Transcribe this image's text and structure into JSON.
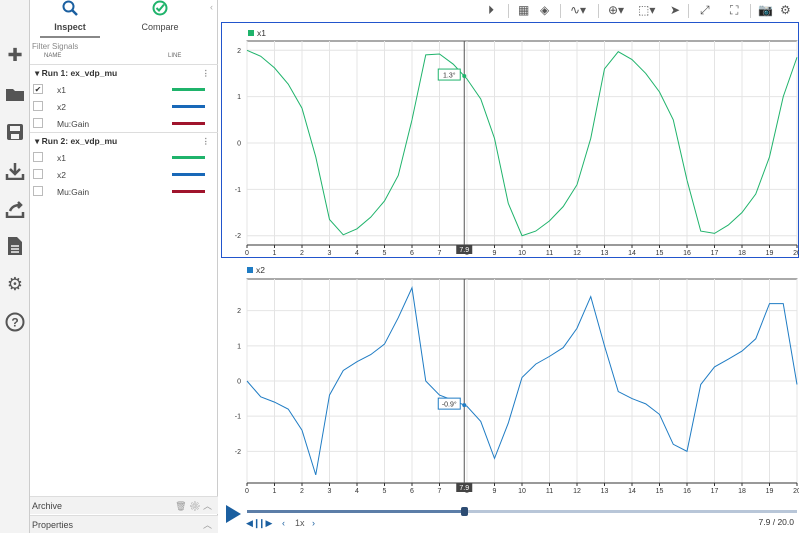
{
  "sidebar_icons": [
    "add-icon",
    "folder-icon",
    "save-icon",
    "download-icon",
    "share-icon",
    "report-icon",
    "settings-icon",
    "help-icon"
  ],
  "tabs": {
    "inspect": "Inspect",
    "compare": "Compare"
  },
  "filter_placeholder": "Filter Signals",
  "columns": {
    "name": "NAME",
    "line": "LINE"
  },
  "runs": [
    {
      "label": "Run 1: ex_vdp_mu",
      "signals": [
        {
          "name": "x1",
          "color": "#1fb36b",
          "checked": true
        },
        {
          "name": "x2",
          "color": "#1868b8",
          "checked": false
        },
        {
          "name": "Mu:Gain",
          "color": "#a0142c",
          "checked": false
        }
      ]
    },
    {
      "label": "Run 2: ex_vdp_mu",
      "signals": [
        {
          "name": "x1",
          "color": "#1fb36b",
          "checked": false
        },
        {
          "name": "x2",
          "color": "#1868b8",
          "checked": false
        },
        {
          "name": "Mu:Gain",
          "color": "#a0142c",
          "checked": false
        }
      ]
    }
  ],
  "archive": "Archive",
  "properties": "Properties",
  "toolbar_icons": [
    "play-record-icon",
    "layout-icon",
    "eraser-icon",
    "signal-style-icon",
    "zoom-icon",
    "fit-icon",
    "cursor-icon",
    "expand-icon",
    "fullscreen-icon",
    "camera-icon",
    "settings-icon"
  ],
  "cursor_time": 7.9,
  "playback": {
    "speed": "1x",
    "time": "7.9 / 20.0",
    "progress": 0.395
  },
  "chart_data": [
    {
      "type": "line",
      "title": "x1",
      "color": "#1fb36b",
      "xlim": [
        0,
        20
      ],
      "ylim": [
        -2.2,
        2.2
      ],
      "yticks": [
        -2,
        -1,
        0,
        1,
        2
      ],
      "xticks": [
        0,
        1,
        2,
        3,
        4,
        5,
        6,
        7,
        8,
        9,
        10,
        11,
        12,
        13,
        14,
        15,
        16,
        17,
        18,
        19,
        20
      ],
      "cursor_value": "1.3°",
      "x": [
        0,
        0.5,
        1,
        1.5,
        2,
        2.5,
        3,
        3.5,
        4,
        4.5,
        5,
        5.5,
        6,
        6.5,
        7,
        7.5,
        8,
        8.5,
        9,
        9.5,
        10,
        10.5,
        11,
        11.5,
        12,
        12.5,
        13,
        13.5,
        14,
        14.5,
        15,
        15.5,
        16,
        16.5,
        17,
        17.5,
        18,
        18.5,
        19,
        19.5,
        20
      ],
      "y": [
        2.0,
        1.87,
        1.62,
        1.27,
        0.75,
        -0.3,
        -1.65,
        -1.98,
        -1.85,
        -1.6,
        -1.25,
        -0.7,
        0.5,
        1.9,
        1.92,
        1.7,
        1.38,
        0.95,
        0.1,
        -1.3,
        -2.0,
        -1.9,
        -1.68,
        -1.37,
        -0.9,
        0.1,
        1.6,
        1.97,
        1.8,
        1.5,
        1.1,
        0.5,
        -0.8,
        -1.9,
        -1.95,
        -1.77,
        -1.5,
        -1.1,
        -0.3,
        1.0,
        1.85
      ]
    },
    {
      "type": "line",
      "title": "x2",
      "color": "#1f7cc4",
      "xlim": [
        0,
        20
      ],
      "ylim": [
        -2.9,
        2.9
      ],
      "yticks": [
        -2,
        -1,
        0,
        1,
        2
      ],
      "xticks": [
        0,
        1,
        2,
        3,
        4,
        5,
        6,
        7,
        8,
        9,
        10,
        11,
        12,
        13,
        14,
        15,
        16,
        17,
        18,
        19,
        20
      ],
      "cursor_value": "-0.9°",
      "x": [
        0,
        0.5,
        1,
        1.5,
        2,
        2.5,
        3,
        3.5,
        4,
        4.5,
        5,
        5.5,
        6,
        6.5,
        7,
        7.5,
        8,
        8.5,
        9,
        9.5,
        10,
        10.5,
        11,
        11.5,
        12,
        12.5,
        13,
        13.5,
        14,
        14.5,
        15,
        15.5,
        16,
        16.5,
        17,
        17.5,
        18,
        18.5,
        19,
        19.5,
        20
      ],
      "y": [
        0,
        -0.45,
        -0.6,
        -0.8,
        -1.4,
        -2.67,
        -0.4,
        0.3,
        0.55,
        0.75,
        1.05,
        1.8,
        2.65,
        0.0,
        -0.4,
        -0.55,
        -0.72,
        -1.15,
        -2.2,
        -1.2,
        0.1,
        0.48,
        0.7,
        0.95,
        1.5,
        2.4,
        1.0,
        -0.3,
        -0.5,
        -0.65,
        -0.95,
        -1.8,
        -2.0,
        -0.1,
        0.4,
        0.62,
        0.85,
        1.2,
        2.2,
        2.2,
        -0.1
      ]
    }
  ]
}
